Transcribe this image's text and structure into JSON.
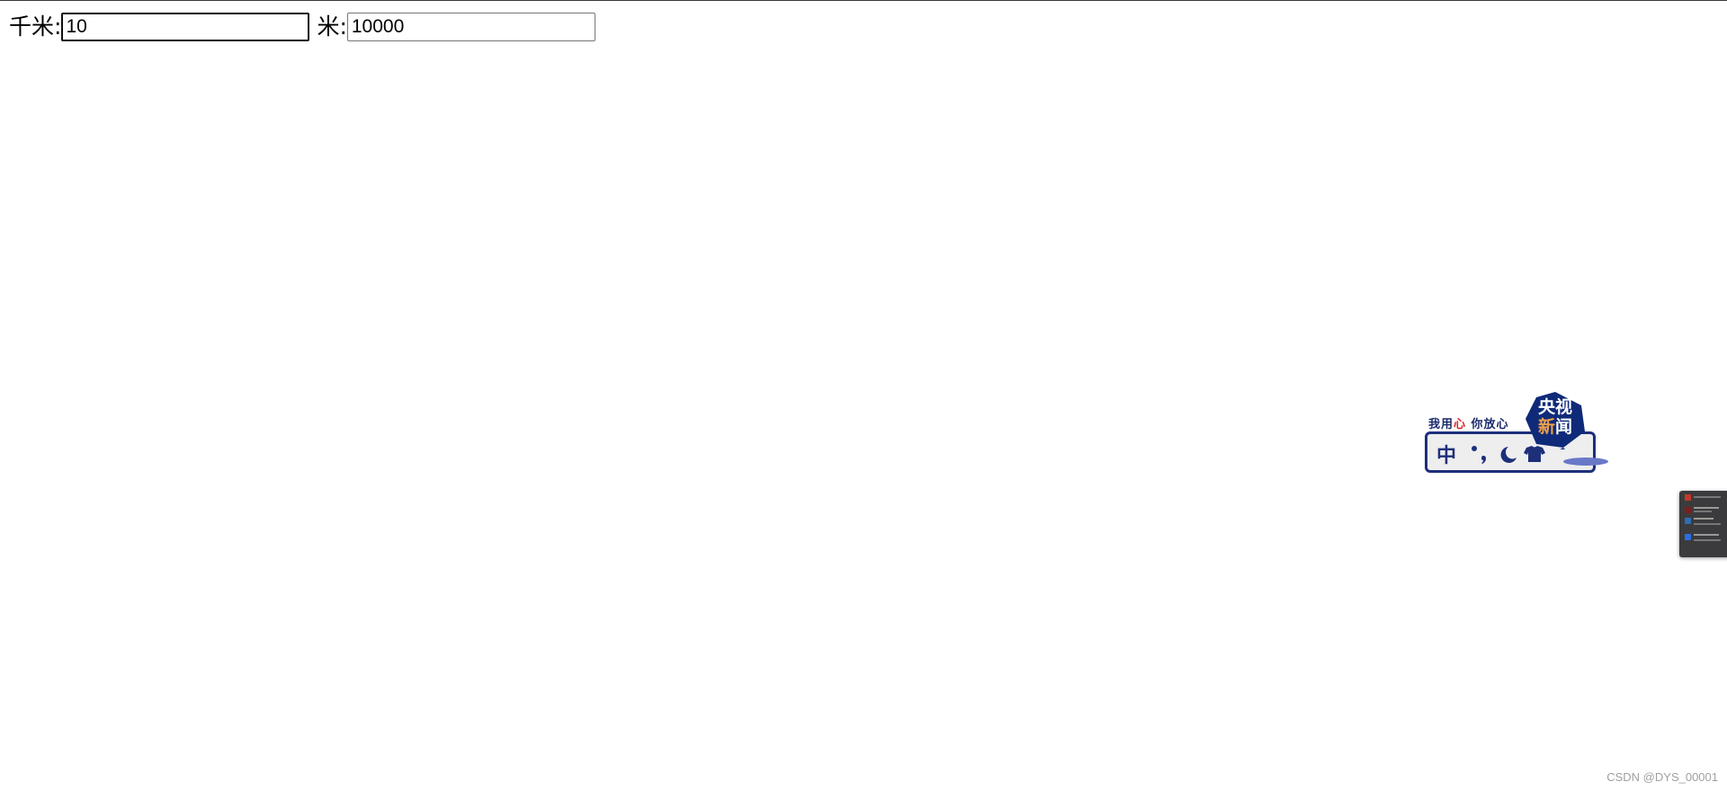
{
  "form": {
    "km_label": "千米:",
    "km_value": "10",
    "m_label": "米:",
    "m_value": "10000"
  },
  "ime_widget": {
    "slogan_part1": "我用",
    "slogan_heart": "心",
    "slogan_part2": " 你放心",
    "mode_text": "中",
    "logo_line1": "央视",
    "logo_line2_a": "新",
    "logo_line2_b": "闻",
    "icons": [
      "punctuation-icon",
      "moon-icon",
      "shirt-icon"
    ],
    "colors": {
      "navy": "#1e2f7a",
      "red": "#d8262b",
      "orange": "#f0a04a"
    }
  },
  "edge_panel": {
    "icon": "taskbar-preview-panel"
  },
  "watermark": "CSDN @DYS_00001"
}
